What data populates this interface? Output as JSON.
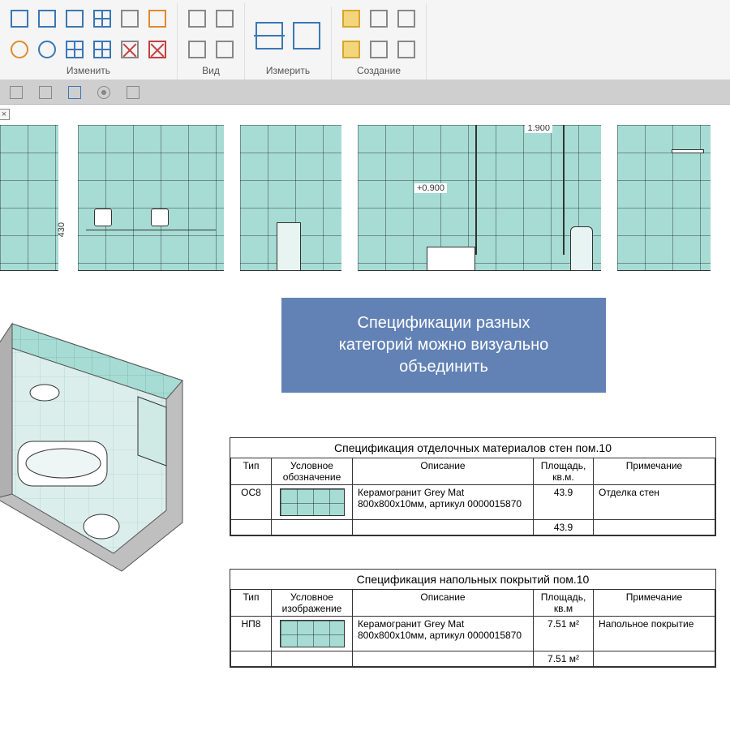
{
  "ribbon": {
    "groups": {
      "modify": {
        "label": "Изменить"
      },
      "view": {
        "label": "Вид"
      },
      "measure": {
        "label": "Измерить"
      },
      "create": {
        "label": "Создание"
      }
    }
  },
  "callout": {
    "line1": "Спецификации разных",
    "line2": "категорий можно визуально",
    "line3": "объединить"
  },
  "elev": {
    "dim1": "1.900",
    "dim2": "+0.900",
    "dim_left": "430"
  },
  "spec1": {
    "title": "Спецификация отделочных материалов стен пом.10",
    "cols": {
      "type": "Тип",
      "symbol": "Условное обозначение",
      "descr": "Описание",
      "area": "Площадь, кв.м.",
      "note": "Примечание"
    },
    "row": {
      "type": "ОС8",
      "descr": "Керамогранит Grey Mat 800х800х10мм, артикул 0000015870",
      "area": "43.9",
      "note": "Отделка стен"
    },
    "total": "43.9"
  },
  "spec2": {
    "title": "Спецификация напольных покрытий пом.10",
    "cols": {
      "type": "Тип",
      "symbol": "Условное изображение",
      "descr": "Описание",
      "area": "Площадь, кв.м",
      "note": "Примечание"
    },
    "row": {
      "type": "НП8",
      "descr": "Керамогранит Grey Mat 800х800х10мм, артикул 0000015870",
      "area": "7.51 м²",
      "note": "Напольное покрытие"
    },
    "total": "7.51 м²"
  }
}
